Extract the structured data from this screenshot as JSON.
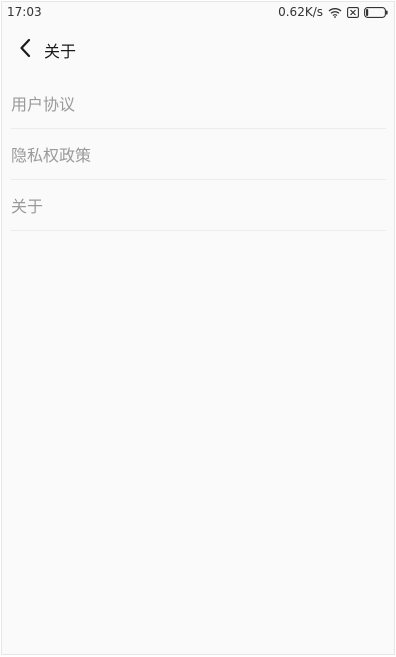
{
  "status_bar": {
    "time": "17:03",
    "speed": "0.62K/s",
    "icons": [
      "wifi-icon",
      "no-sim-icon",
      "battery-icon"
    ]
  },
  "header": {
    "back_icon": "chevron-left-icon",
    "title": "关于"
  },
  "menu": {
    "items": [
      {
        "label": "用户协议"
      },
      {
        "label": "隐私权政策"
      },
      {
        "label": "关于"
      }
    ]
  },
  "colors": {
    "background": "#fafafa",
    "text_primary": "#1a1a1a",
    "text_secondary": "#9a9a9a",
    "divider": "#ececec"
  }
}
